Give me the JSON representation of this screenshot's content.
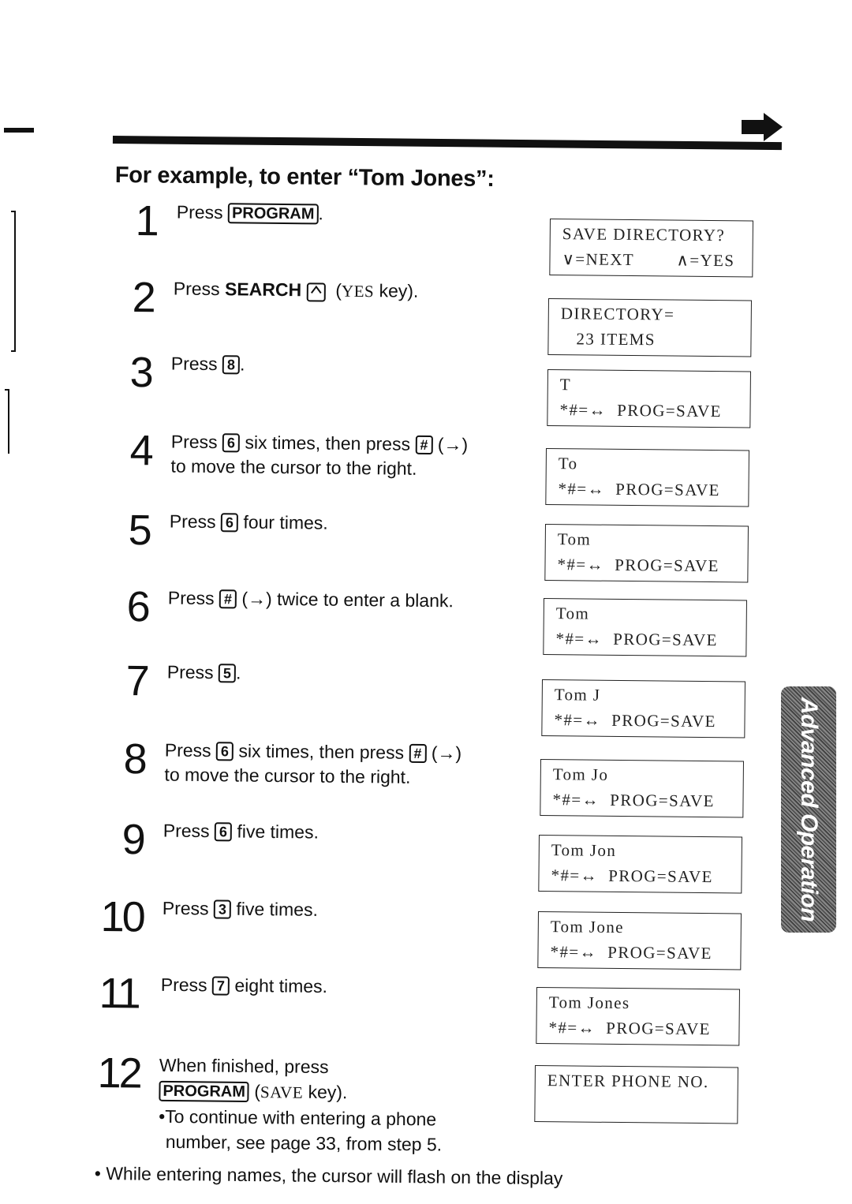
{
  "page": {
    "heading": "For example, to enter “Tom Jones”:",
    "continue_icon": "right-arrow-icon",
    "side_tab_label": "Advanced Operation",
    "footer_note": "• While entering names, the cursor will flash on the display"
  },
  "steps": [
    {
      "number": "1",
      "parts": {
        "pre": "Press ",
        "key": "PROGRAM",
        "post": "."
      }
    },
    {
      "number": "2",
      "parts": {
        "pre": "Press ",
        "bold": "SEARCH",
        "key_icon": "up-arrow-key-icon",
        "post_sc": "YES",
        "post": " key)."
      }
    },
    {
      "number": "3",
      "parts": {
        "pre": "Press ",
        "key": "8",
        "post": "."
      }
    },
    {
      "number": "4",
      "parts": {
        "pre": "Press ",
        "key": "6",
        "mid": " six times, then press ",
        "key2": "#",
        "post": " (→)",
        "line2": "to move the cursor to the right."
      }
    },
    {
      "number": "5",
      "parts": {
        "pre": "Press ",
        "key": "6",
        "post": " four times."
      }
    },
    {
      "number": "6",
      "parts": {
        "pre": "Press ",
        "key": "#",
        "post": " (→) twice to enter a blank."
      }
    },
    {
      "number": "7",
      "parts": {
        "pre": "Press ",
        "key": "5",
        "post": "."
      }
    },
    {
      "number": "8",
      "parts": {
        "pre": "Press ",
        "key": "6",
        "mid": " six times, then press ",
        "key2": "#",
        "post": " (→)",
        "line2": "to move the cursor to the right."
      }
    },
    {
      "number": "9",
      "parts": {
        "pre": "Press ",
        "key": "6",
        "post": " five times."
      }
    },
    {
      "number": "10",
      "parts": {
        "pre": "Press ",
        "key": "3",
        "post": " five times."
      }
    },
    {
      "number": "11",
      "parts": {
        "pre": "Press ",
        "key": "7",
        "post": " eight times."
      }
    },
    {
      "number": "12",
      "parts": {
        "line1": "When finished, press",
        "key": "PROGRAM",
        "post_sc": "SAVE",
        "post": " key).",
        "bullet1": "•To continue with entering a phone",
        "bullet2": "number, see page 33, from step 5."
      }
    }
  ],
  "displays": [
    {
      "line1": "SAVE DIRECTORY?",
      "line2_left": "∨=NEXT",
      "line2_right": "∧=YES"
    },
    {
      "line1": "DIRECTORY=",
      "line2": "   23 ITEMS"
    },
    {
      "line1": "T",
      "line2": "*#=↔  PROG=SAVE"
    },
    {
      "line1": "To",
      "line2": "*#=↔  PROG=SAVE"
    },
    {
      "line1": "Tom",
      "line2": "*#=↔  PROG=SAVE"
    },
    {
      "line1": "Tom",
      "line2": "*#=↔  PROG=SAVE"
    },
    {
      "line1": "Tom J",
      "line2": "*#=↔  PROG=SAVE"
    },
    {
      "line1": "Tom Jo",
      "line2": "*#=↔  PROG=SAVE"
    },
    {
      "line1": "Tom Jon",
      "line2": "*#=↔  PROG=SAVE"
    },
    {
      "line1": "Tom Jone",
      "line2": "*#=↔  PROG=SAVE"
    },
    {
      "line1": "Tom Jones",
      "line2": "*#=↔  PROG=SAVE"
    },
    {
      "line1": "ENTER PHONE NO.",
      "line2": ""
    }
  ]
}
